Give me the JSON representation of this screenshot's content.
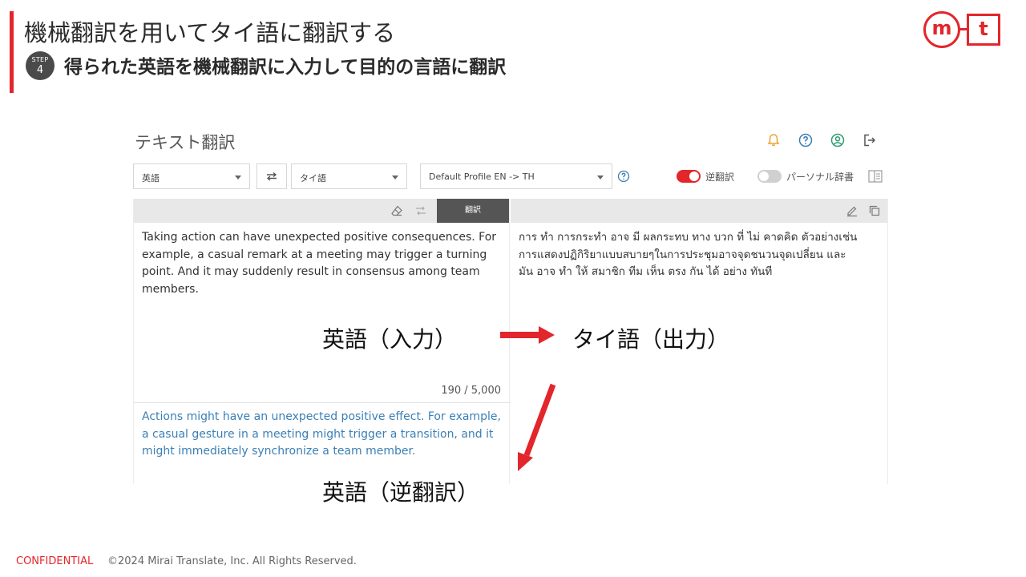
{
  "slide": {
    "title": "機械翻訳を用いてタイ語に翻訳する",
    "step_word": "STEP",
    "step_number": "4",
    "subtitle": "得られた英語を機械翻訳に入力して目的の言語に翻訳",
    "logo_m": "m",
    "logo_t": "t",
    "accent_color": "#e3262b"
  },
  "footer": {
    "confidential": "CONFIDENTIAL",
    "copyright": "©2024 Mirai Translate, Inc. All Rights Reserved."
  },
  "app": {
    "title": "テキスト翻訳",
    "header_icons": [
      "bell-icon",
      "help-circle-icon",
      "account-icon",
      "logout-icon"
    ],
    "source_language": "英語",
    "target_language": "タイ語",
    "profile": "Default Profile EN -> TH",
    "back_translation_label": "逆翻訳",
    "back_translation_on": true,
    "personal_dict_label": "パーソナル辞書",
    "personal_dict_on": false,
    "translate_button": "翻訳",
    "source_text": "Taking action can have unexpected positive consequences. For example, a casual remark at a meeting may trigger a turning point. And it may suddenly result in consensus among team members.",
    "char_count": "190 / 5,000",
    "back_translation_text": "Actions might have an unexpected positive effect. For example, a casual gesture in a meeting might trigger a transition, and it might immediately synchronize a team member.",
    "target_text": "การ ทำ การกระทำ อาจ มี ผลกระทบ ทาง บวก ที่ ไม่ คาดคิด ตัวอย่างเช่น การแสดงปฏิกิริยาแบบสบายๆในการประชุมอาจจุดชนวนจุดเปลี่ยน และ มัน อาจ ทำ ให้ สมาชิก ทีม เห็น ตรง กัน ได้ อย่าง ทันที"
  },
  "annotations": {
    "input_label": "英語（入力）",
    "output_label": "タイ語（出力）",
    "back_label": "英語（逆翻訳）",
    "arrow_color": "#e3262b"
  }
}
